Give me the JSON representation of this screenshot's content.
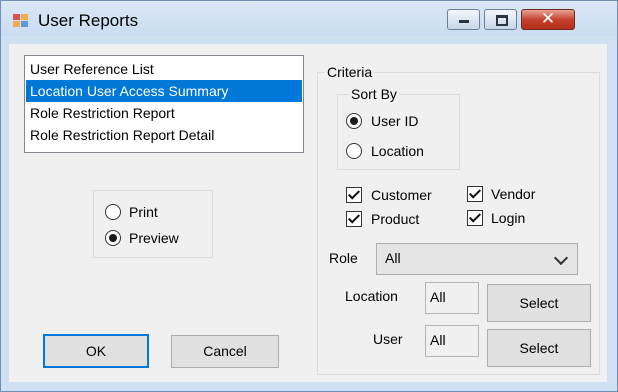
{
  "window": {
    "title": "User Reports",
    "close_glyph": "✕"
  },
  "reports": {
    "items": [
      {
        "label": "User Reference List",
        "selected": false
      },
      {
        "label": "Location User Access Summary",
        "selected": true
      },
      {
        "label": "Role Restriction Report",
        "selected": false
      },
      {
        "label": "Role Restriction Report Detail",
        "selected": false
      }
    ]
  },
  "output": {
    "print_label": "Print",
    "preview_label": "Preview",
    "selected": "Preview"
  },
  "criteria": {
    "title": "Criteria",
    "sort_by": {
      "title": "Sort By",
      "user_id_label": "User ID",
      "location_label": "Location",
      "selected": "User ID"
    },
    "checks": {
      "customer": {
        "label": "Customer",
        "checked": true
      },
      "vendor": {
        "label": "Vendor",
        "checked": true
      },
      "product": {
        "label": "Product",
        "checked": true
      },
      "login": {
        "label": "Login",
        "checked": true
      }
    },
    "role": {
      "label": "Role",
      "value": "All"
    },
    "location": {
      "label": "Location",
      "value": "All",
      "button": "Select"
    },
    "user": {
      "label": "User",
      "value": "All",
      "button": "Select"
    }
  },
  "buttons": {
    "ok": "OK",
    "cancel": "Cancel"
  },
  "colors": {
    "selection": "#0078d7",
    "close_button": "#c7432f",
    "titlebar": "#cfe0f3"
  }
}
